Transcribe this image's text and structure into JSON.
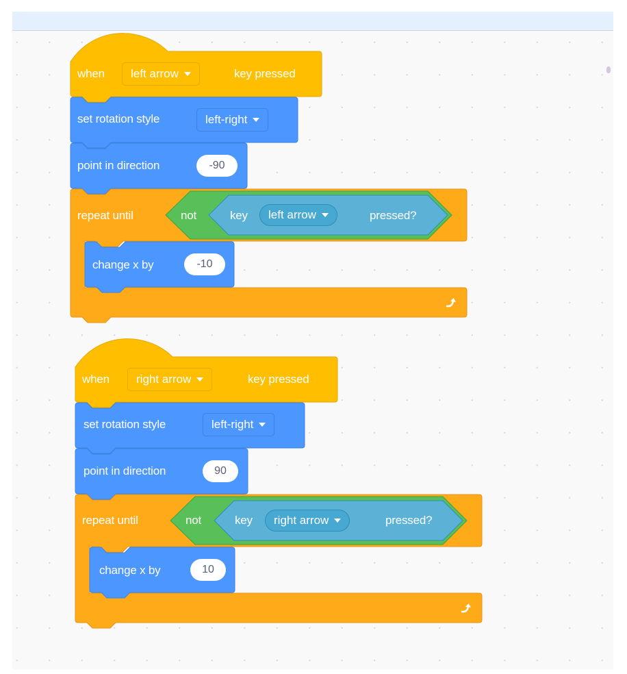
{
  "workspace": {
    "scripts": [
      {
        "hat": {
          "prefix": "when",
          "key_option": "left arrow",
          "suffix": "key pressed"
        },
        "rotation": {
          "label": "set rotation style",
          "option": "left-right"
        },
        "point": {
          "label": "point in direction",
          "value": "-90"
        },
        "repeat": {
          "label": "repeat until",
          "not_label": "not",
          "sense_prefix": "key",
          "sense_option": "left arrow",
          "sense_suffix": "pressed?"
        },
        "change": {
          "label": "change x by",
          "value": "-10"
        }
      },
      {
        "hat": {
          "prefix": "when",
          "key_option": "right arrow",
          "suffix": "key pressed"
        },
        "rotation": {
          "label": "set rotation style",
          "option": "left-right"
        },
        "point": {
          "label": "point in direction",
          "value": "90"
        },
        "repeat": {
          "label": "repeat until",
          "not_label": "not",
          "sense_prefix": "key",
          "sense_option": "right arrow",
          "sense_suffix": "pressed?"
        },
        "change": {
          "label": "change x by",
          "value": "10"
        }
      }
    ]
  },
  "colors": {
    "events": "#ffbf00",
    "motion": "#4c97ff",
    "control": "#ffab19",
    "operators": "#59c059",
    "sensing": "#5cb1d6"
  }
}
